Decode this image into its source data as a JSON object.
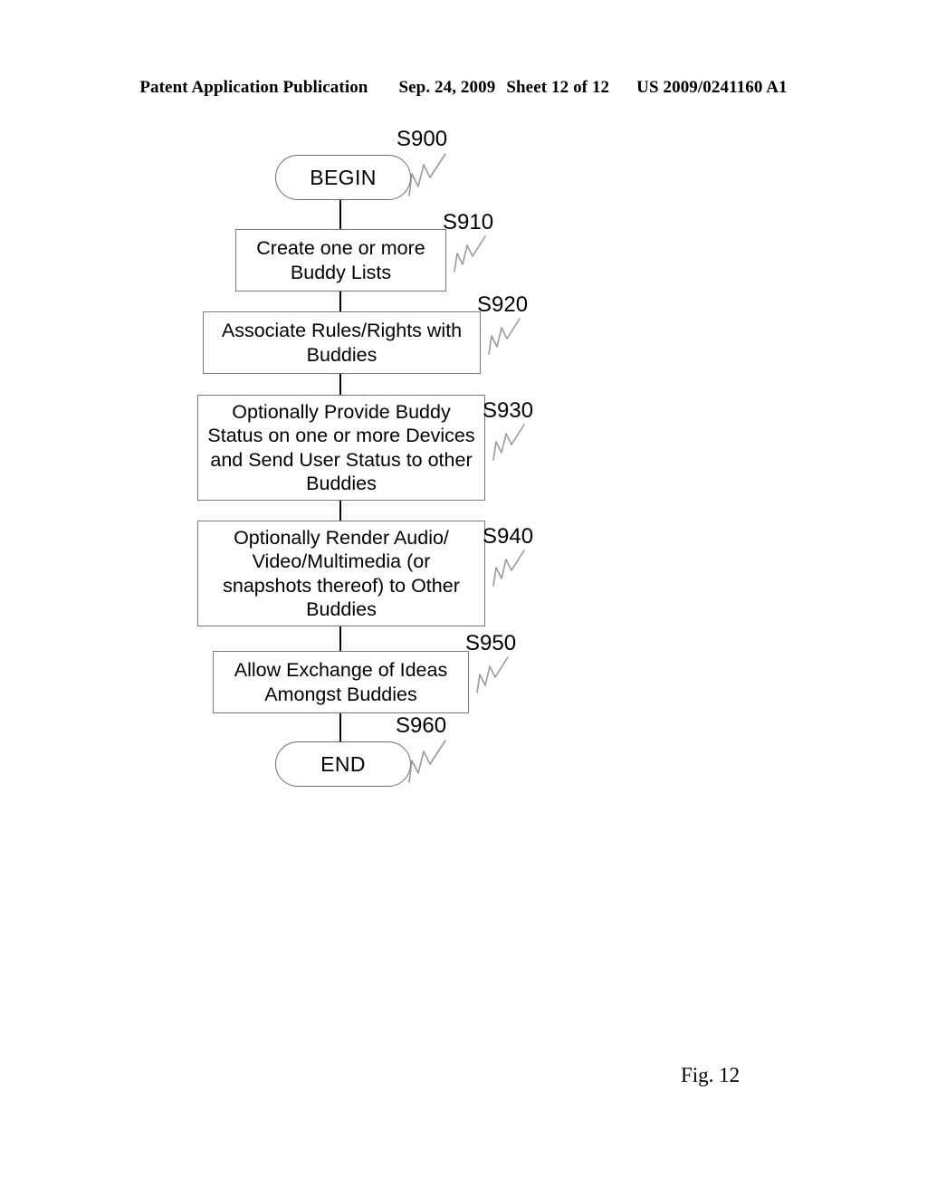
{
  "header": {
    "publication": "Patent Application Publication",
    "date": "Sep. 24, 2009",
    "sheet": "Sheet 12 of 12",
    "doc_number": "US 2009/0241160 A1"
  },
  "figure": {
    "caption": "Fig. 12"
  },
  "flowchart": {
    "nodes": [
      {
        "id": "S900",
        "shape": "terminator",
        "text": "BEGIN",
        "label": "S900"
      },
      {
        "id": "S910",
        "shape": "process",
        "text": "Create one or more\nBuddy Lists",
        "label": "S910"
      },
      {
        "id": "S920",
        "shape": "process",
        "text": "Associate Rules/Rights with\nBuddies",
        "label": "S920"
      },
      {
        "id": "S930",
        "shape": "process",
        "text": "Optionally Provide Buddy\nStatus on one or more Devices\nand Send User Status to other\nBuddies",
        "label": "S930"
      },
      {
        "id": "S940",
        "shape": "process",
        "text": "Optionally Render Audio/\nVideo/Multimedia (or\nsnapshots thereof) to Other\nBuddies",
        "label": "S940"
      },
      {
        "id": "S950",
        "shape": "process",
        "text": "Allow Exchange of Ideas\nAmongst Buddies",
        "label": "S950"
      },
      {
        "id": "S960",
        "shape": "terminator",
        "text": "END",
        "label": "S960"
      }
    ],
    "colors": {
      "line": "#000000",
      "box_border": "#7a7a7a",
      "leader": "#9a9a9a",
      "text": "#000000",
      "background": "#ffffff"
    }
  }
}
